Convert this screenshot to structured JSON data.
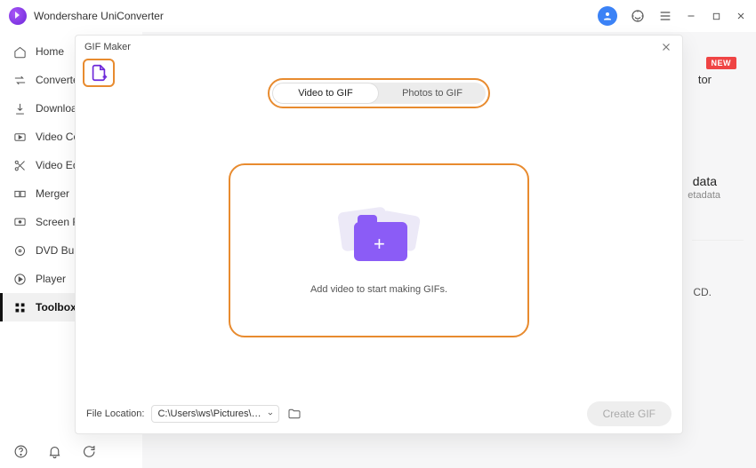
{
  "app": {
    "title": "Wondershare UniConverter"
  },
  "sidebar": {
    "items": [
      {
        "label": "Home"
      },
      {
        "label": "Converter"
      },
      {
        "label": "Downloader"
      },
      {
        "label": "Video Compressor"
      },
      {
        "label": "Video Editor"
      },
      {
        "label": "Merger"
      },
      {
        "label": "Screen Recorder"
      },
      {
        "label": "DVD Burner"
      },
      {
        "label": "Player"
      },
      {
        "label": "Toolbox"
      }
    ]
  },
  "dialog": {
    "title": "GIF Maker",
    "tabs": {
      "video": "Video to GIF",
      "photos": "Photos to GIF"
    },
    "dropzone_text": "Add video to start making GIFs.",
    "footer": {
      "label": "File Location:",
      "path": "C:\\Users\\ws\\Pictures\\Wonders",
      "create_label": "Create GIF"
    }
  },
  "backdrop": {
    "new_badge": "NEW",
    "tor": "tor",
    "data": "data",
    "etadata": "etadata",
    "cd": "CD."
  }
}
